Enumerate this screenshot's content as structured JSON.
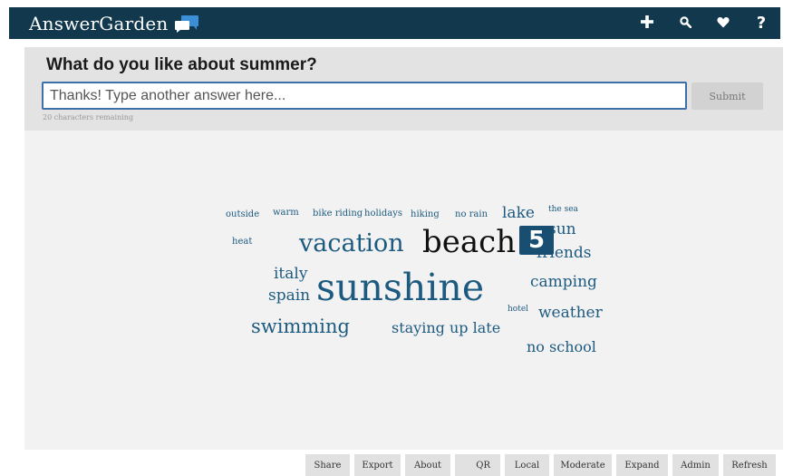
{
  "header": {
    "logo_text": "AnswerGarden",
    "nav": [
      {
        "name": "plus-icon",
        "glyph": "+"
      },
      {
        "name": "search-icon",
        "glyph": "search"
      },
      {
        "name": "heart-icon",
        "glyph": "heart"
      },
      {
        "name": "help-icon",
        "glyph": "?"
      }
    ],
    "help_glyph": "?"
  },
  "question": {
    "title": "What do you like about summer?",
    "input_placeholder": "Thanks! Type another answer here...",
    "input_value": "",
    "submit_label": "Submit",
    "chars_remaining": "20 characters remaining"
  },
  "cloud": {
    "highlight_count": "5",
    "words": [
      {
        "text": "outside"
      },
      {
        "text": "warm"
      },
      {
        "text": "bike riding"
      },
      {
        "text": "holidays"
      },
      {
        "text": "hiking"
      },
      {
        "text": "no rain"
      },
      {
        "text": "lake"
      },
      {
        "text": "the sea"
      },
      {
        "text": "heat"
      },
      {
        "text": "vacation"
      },
      {
        "text": "beach"
      },
      {
        "text": "sun"
      },
      {
        "text": "friends"
      },
      {
        "text": "italy"
      },
      {
        "text": "spain"
      },
      {
        "text": "sunshine"
      },
      {
        "text": "camping"
      },
      {
        "text": "hotel"
      },
      {
        "text": "weather"
      },
      {
        "text": "swimming"
      },
      {
        "text": "staying up late"
      },
      {
        "text": "no school"
      }
    ]
  },
  "footer": {
    "buttons": [
      "Share",
      "Export",
      "About",
      "QR",
      "Local",
      "Moderate",
      "Expand",
      "Admin",
      "Refresh"
    ]
  },
  "colors": {
    "header_bg": "#12384e",
    "word_color": "#1d5a80",
    "badge_bg": "#184e72",
    "input_border": "#3d6fa8"
  }
}
